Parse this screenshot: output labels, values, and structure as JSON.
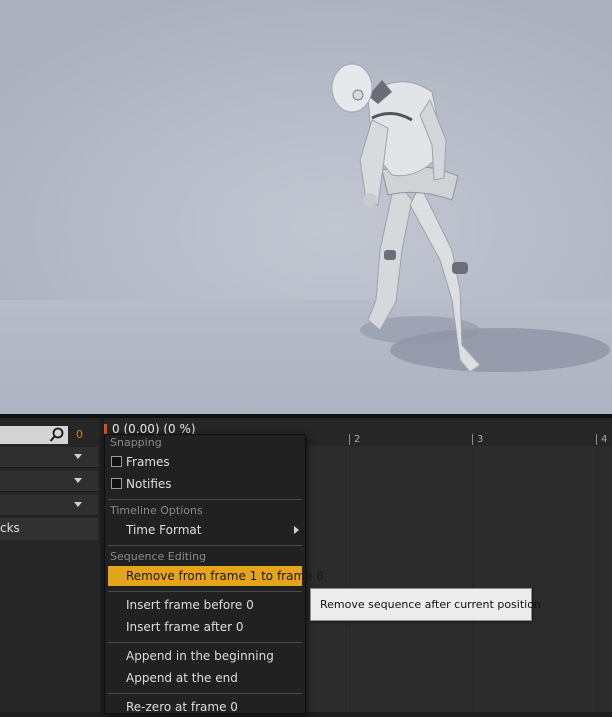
{
  "toolbar": {
    "frame_counter": "0"
  },
  "left_panel": {
    "tracks_label": "cks"
  },
  "timeline": {
    "time_readout": "0 (0.00) (0 %)",
    "tick_labels": [
      "2",
      "3",
      "4"
    ]
  },
  "context_menu": {
    "snapping_header": "Snapping",
    "frames_label": "Frames",
    "frames_checked": false,
    "notifies_label": "Notifies",
    "notifies_checked": false,
    "timeline_options_header": "Timeline Options",
    "time_format_label": "Time Format",
    "sequence_editing_header": "Sequence Editing",
    "remove_label": "Remove from frame 1 to frame 8",
    "insert_before_label": "Insert frame before 0",
    "insert_after_label": "Insert frame after 0",
    "append_beginning_label": "Append in the beginning",
    "append_end_label": "Append at the end",
    "rezero_label": "Re-zero at frame 0"
  },
  "tooltip": {
    "text": "Remove sequence after current position"
  },
  "colors": {
    "highlight": "#e5a51b",
    "frame_counter": "#e07a1a",
    "playhead": "#d2551a",
    "viewport_bg": "#b4bac6"
  }
}
